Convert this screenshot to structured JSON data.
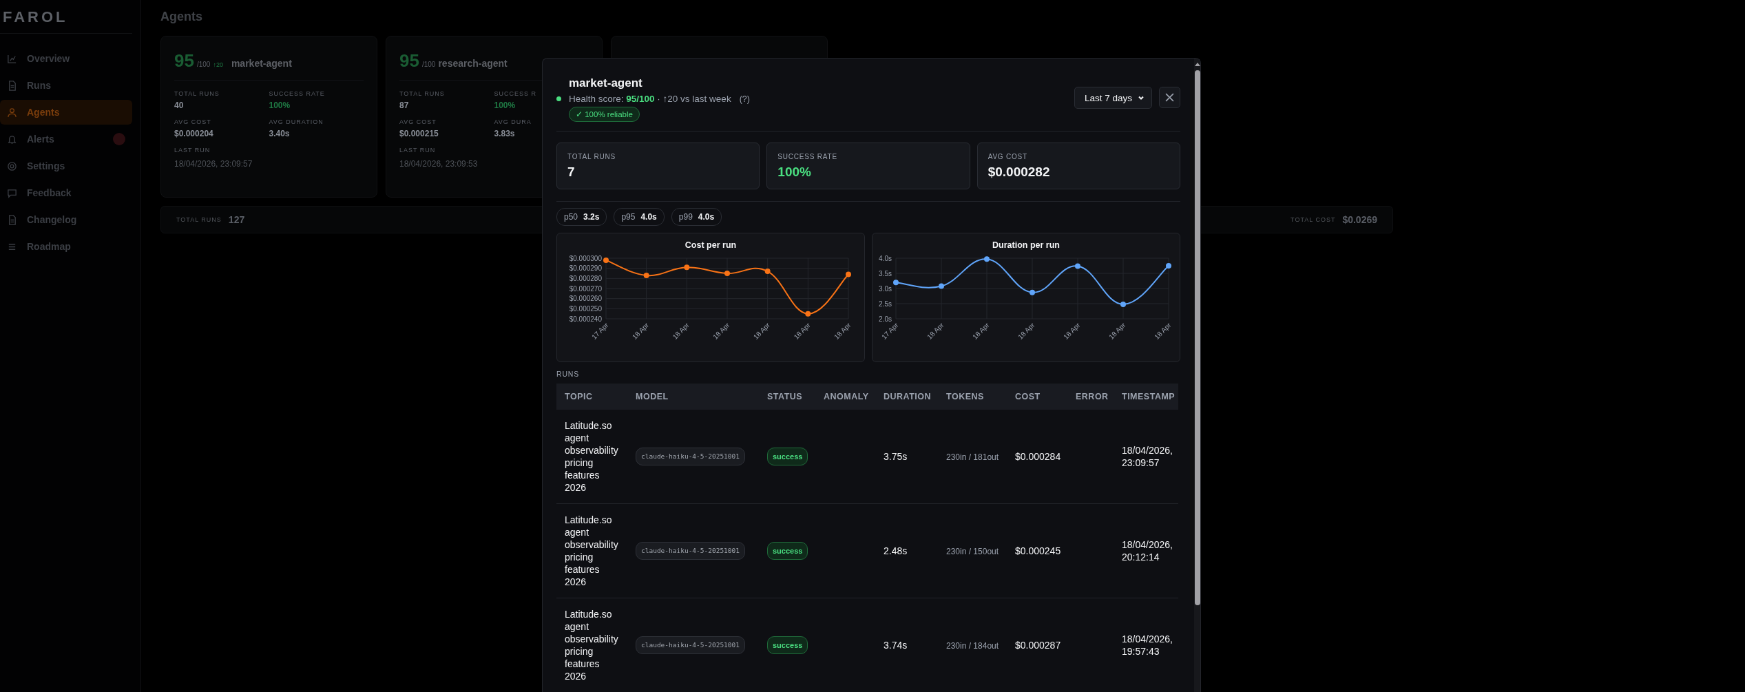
{
  "sidebar": {
    "brand": "FAROL",
    "items": [
      {
        "label": "Overview",
        "selected": false
      },
      {
        "label": "Runs",
        "selected": false
      },
      {
        "label": "Agents",
        "selected": true
      },
      {
        "label": "Alerts",
        "selected": false,
        "badge": true
      },
      {
        "label": "Settings",
        "selected": false
      },
      {
        "label": "Feedback",
        "selected": false
      },
      {
        "label": "Changelog",
        "selected": false
      },
      {
        "label": "Roadmap",
        "selected": false
      }
    ]
  },
  "page_title": "Agents",
  "agent_cards": [
    {
      "score": "95",
      "score_max": "/100",
      "delta": "↑20",
      "name": "market-agent",
      "metrics": [
        {
          "label": "TOTAL RUNS",
          "value": "40",
          "color": "#8a8f98"
        },
        {
          "label": "SUCCESS RATE",
          "value": "100%",
          "color": "#1f7a44"
        },
        {
          "label": "AVG COST",
          "value": "$0.000204",
          "color": "#8a8f98"
        },
        {
          "label": "AVG DURATION",
          "value": "3.40s",
          "color": "#8a8f98"
        }
      ],
      "last_run_label": "LAST RUN",
      "last_run": "18/04/2026, 23:09:57"
    },
    {
      "score": "95",
      "score_max": "/100",
      "name": "research-agent",
      "metrics": [
        {
          "label": "TOTAL RUNS",
          "value": "87",
          "color": "#8a8f98"
        },
        {
          "label": "SUCCESS R",
          "value": "100%",
          "color": "#1f7a44"
        },
        {
          "label": "AVG COST",
          "value": "$0.000215",
          "color": "#8a8f98"
        },
        {
          "label": "AVG DURA",
          "value": "3.83s",
          "color": "#8a8f98"
        }
      ],
      "last_run_label": "LAST RUN",
      "last_run": "18/04/2026, 23:09:53"
    },
    {
      "kind": "covered"
    }
  ],
  "totals": [
    {
      "label": "TOTAL RUNS",
      "value": "127"
    },
    {
      "label": "TOTAL COST",
      "value": "$0.0269"
    }
  ],
  "modal": {
    "title": "market-agent",
    "health": "Health score: **95/100** · ↑20 vs last week",
    "help": "(?)",
    "reliability_badge": "✓ 100% reliable",
    "range": "Last 7 days",
    "stats": [
      {
        "label": "TOTAL RUNS",
        "value": "7",
        "color": "#f3f4f6"
      },
      {
        "label": "SUCCESS RATE",
        "value": "100%",
        "color": "#4ade80"
      },
      {
        "label": "AVG COST",
        "value": "$0.000282",
        "color": "#f3f4f6"
      }
    ],
    "percentiles": [
      {
        "label": "p50",
        "value": "3.2s"
      },
      {
        "label": "p95",
        "value": "4.0s"
      },
      {
        "label": "p99",
        "value": "4.0s"
      }
    ],
    "charts": [
      {
        "chart_data": {
          "type": "line",
          "title": "Cost per run",
          "categories": [
            "17 Apr",
            "18 Apr",
            "18 Apr",
            "18 Apr",
            "18 Apr",
            "18 Apr",
            "18 Apr"
          ],
          "grid": true,
          "series": [
            {
              "color": "#f97316",
              "marker": true,
              "values": [
                0.000298,
                0.000283,
                0.000291,
                0.000285,
                0.000287,
                0.000245,
                0.000284
              ]
            }
          ],
          "ylim": [
            0.00024,
            0.0003
          ],
          "yticks": [
            {
              "value": 0.00024,
              "label": "$0.000240"
            },
            {
              "value": 0.00025,
              "label": "$0.000250"
            },
            {
              "value": 0.00026,
              "label": "$0.000260"
            },
            {
              "value": 0.00027,
              "label": "$0.000270"
            },
            {
              "value": 0.00028,
              "label": "$0.000280"
            },
            {
              "value": 0.00029,
              "label": "$0.000290"
            },
            {
              "value": 0.0003,
              "label": "$0.000300"
            }
          ]
        }
      },
      {
        "chart_data": {
          "type": "line",
          "title": "Duration per run",
          "categories": [
            "17 Apr",
            "18 Apr",
            "18 Apr",
            "18 Apr",
            "18 Apr",
            "18 Apr",
            "18 Apr"
          ],
          "grid": true,
          "series": [
            {
              "color": "#60a5fa",
              "marker": true,
              "values": [
                3.2,
                3.08,
                3.97,
                2.87,
                3.74,
                2.48,
                3.75
              ]
            }
          ],
          "ylim": [
            2.0,
            4.0
          ],
          "yticks": [
            {
              "value": 2.0,
              "label": "2.0s"
            },
            {
              "value": 2.5,
              "label": "2.5s"
            },
            {
              "value": 3.0,
              "label": "3.0s"
            },
            {
              "value": 3.5,
              "label": "3.5s"
            },
            {
              "value": 4.0,
              "label": "4.0s"
            }
          ]
        }
      }
    ],
    "runs_label": "RUNS",
    "table": {
      "columns": [
        "TOPIC",
        "MODEL",
        "STATUS",
        "ANOMALY",
        "DURATION",
        "TOKENS",
        "COST",
        "ERROR",
        "TIMESTAMP"
      ],
      "rows": [
        {
          "topic": "Latitude.so agent observability pricing features 2026",
          "model": "claude-haiku-4-5-20251001",
          "status": "success",
          "duration": "3.75s",
          "tokens": "230in / 181out",
          "cost": "$0.000284",
          "timestamp": "18/04/2026, 23:09:57"
        },
        {
          "topic": "Latitude.so agent observability pricing features 2026",
          "model": "claude-haiku-4-5-20251001",
          "status": "success",
          "duration": "2.48s",
          "tokens": "230in / 150out",
          "cost": "$0.000245",
          "timestamp": "18/04/2026, 20:12:14"
        },
        {
          "topic": "Latitude.so agent observability pricing features 2026",
          "model": "claude-haiku-4-5-20251001",
          "status": "success",
          "duration": "3.74s",
          "tokens": "230in / 184out",
          "cost": "$0.000287",
          "timestamp": "18/04/2026, 19:57:43"
        }
      ]
    }
  }
}
